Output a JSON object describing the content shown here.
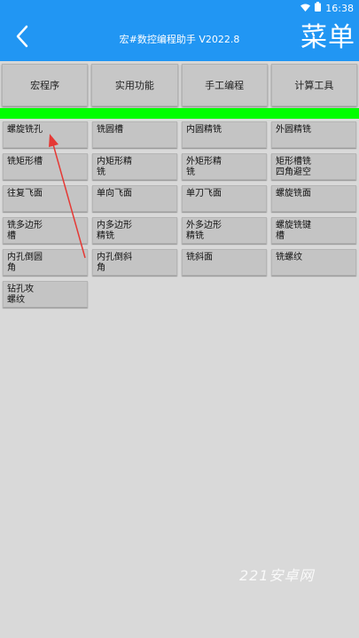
{
  "status_bar": {
    "time": "16:38"
  },
  "header": {
    "title": "宏#数控编程助手 V2022.8",
    "menu_label": "菜单"
  },
  "tabs": [
    {
      "label": "宏程序"
    },
    {
      "label": "实用功能"
    },
    {
      "label": "手工编程"
    },
    {
      "label": "计算工具"
    }
  ],
  "grid": {
    "items": [
      "螺旋铣孔",
      "铣圆槽",
      "内圆精铣",
      "外圆精铣",
      "铣矩形槽",
      "内矩形精\n铣",
      "外矩形精\n铣",
      "矩形槽铣\n四角避空",
      "往复飞面",
      "单向飞面",
      "单刀飞面",
      "螺旋铣面",
      "铣多边形\n槽",
      "内多边形\n精铣",
      "外多边形\n精铣",
      "螺旋铣键\n槽",
      "内孔倒圆\n角",
      "内孔倒斜\n角",
      "铣斜面",
      "铣螺纹",
      "钻孔攻\n螺纹"
    ]
  },
  "watermark": "221安卓网",
  "colors": {
    "app_bar": "#2196f3",
    "separator": "#00ff00",
    "annotation_arrow": "#e53935"
  }
}
